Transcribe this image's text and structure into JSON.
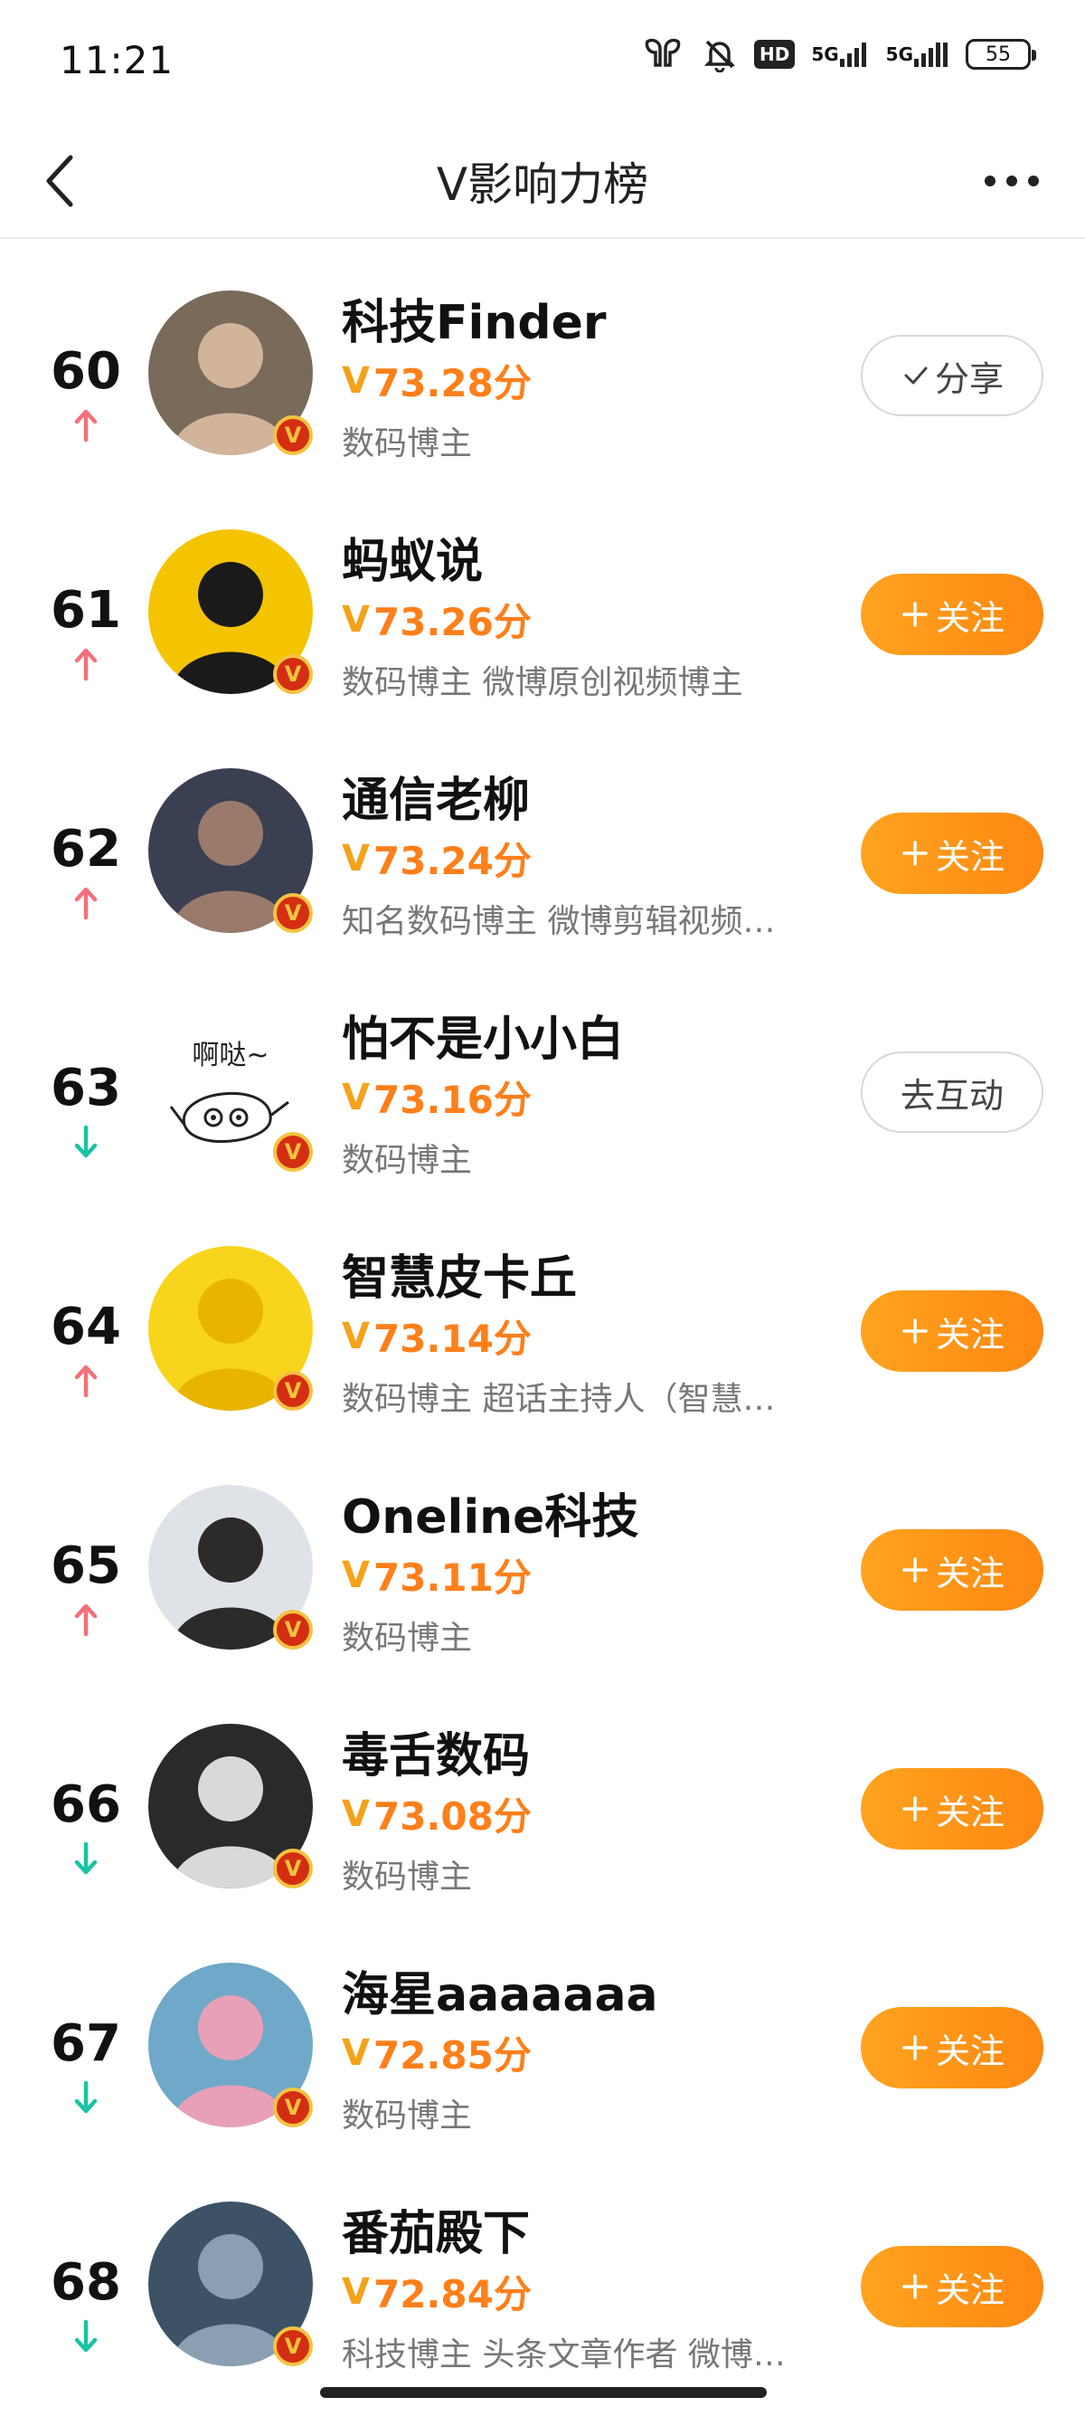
{
  "status_bar": {
    "time": "11:21",
    "icons": [
      "earbuds-icon",
      "bell-muted-icon",
      "hd-voice-icon",
      "signal-5g-icon",
      "signal-5g-icon"
    ],
    "hd_label": "HD",
    "net1": "5G",
    "net2": "5G",
    "battery": "55"
  },
  "nav": {
    "title": "V影响力榜",
    "back_icon": "chevron-left-icon",
    "more_icon": "more-dots-icon"
  },
  "colors": {
    "accent": "#ff8812",
    "score": "#ff7f1a",
    "up": "#f3707a",
    "down": "#19c4a3",
    "badge_red": "#d42e12",
    "badge_gold": "#f5c341"
  },
  "entries": [
    {
      "rank": "60",
      "trend": "up",
      "name": "科技Finder",
      "score": "73.28分",
      "desc": "数码博主",
      "button": "分享",
      "button_type": "outline",
      "button_icon": "check-icon",
      "avatar_bg": "#7a6a5a",
      "avatar_fg": "#d2b49a"
    },
    {
      "rank": "61",
      "trend": "up",
      "name": "蚂蚁说",
      "score": "73.26分",
      "desc": "数码博主 微博原创视频博主",
      "button": "关注",
      "button_type": "follow",
      "button_icon": "plus-icon",
      "avatar_bg": "#f5c400",
      "avatar_fg": "#1a1a1a"
    },
    {
      "rank": "62",
      "trend": "up",
      "name": "通信老柳",
      "score": "73.24分",
      "desc": "知名数码博主 微博剪辑视频…",
      "button": "关注",
      "button_type": "follow",
      "button_icon": "plus-icon",
      "avatar_bg": "#3a3f52",
      "avatar_fg": "#9a7a6a"
    },
    {
      "rank": "63",
      "trend": "down",
      "name": "怕不是小小白",
      "score": "73.16分",
      "desc": "数码博主",
      "button": "去互动",
      "button_type": "outline",
      "button_icon": "",
      "avatar_bg": "#ffffff",
      "avatar_fg": "#222222",
      "avatar_text": "啊哒~"
    },
    {
      "rank": "64",
      "trend": "up",
      "name": "智慧皮卡丘",
      "score": "73.14分",
      "desc": "数码博主 超话主持人（智慧…",
      "button": "关注",
      "button_type": "follow",
      "button_icon": "plus-icon",
      "avatar_bg": "#f7d51d",
      "avatar_fg": "#e8b400"
    },
    {
      "rank": "65",
      "trend": "up",
      "name": "Oneline科技",
      "score": "73.11分",
      "desc": "数码博主",
      "button": "关注",
      "button_type": "follow",
      "button_icon": "plus-icon",
      "avatar_bg": "#dfe2e6",
      "avatar_fg": "#2b2b2b"
    },
    {
      "rank": "66",
      "trend": "down",
      "name": "毒舌数码",
      "score": "73.08分",
      "desc": "数码博主",
      "button": "关注",
      "button_type": "follow",
      "button_icon": "plus-icon",
      "avatar_bg": "#2a2a2a",
      "avatar_fg": "#d9d9d9"
    },
    {
      "rank": "67",
      "trend": "down",
      "name": "海星aaaaaaa",
      "score": "72.85分",
      "desc": "数码博主",
      "button": "关注",
      "button_type": "follow",
      "button_icon": "plus-icon",
      "avatar_bg": "#6fa8c8",
      "avatar_fg": "#e8a0b8"
    },
    {
      "rank": "68",
      "trend": "down",
      "name": "番茄殿下",
      "score": "72.84分",
      "desc": "科技博主 头条文章作者 微博…",
      "button": "关注",
      "button_type": "follow",
      "button_icon": "plus-icon",
      "avatar_bg": "#3d5266",
      "avatar_fg": "#8aa0b2"
    }
  ],
  "badge_label": "V",
  "score_prefix": "V"
}
